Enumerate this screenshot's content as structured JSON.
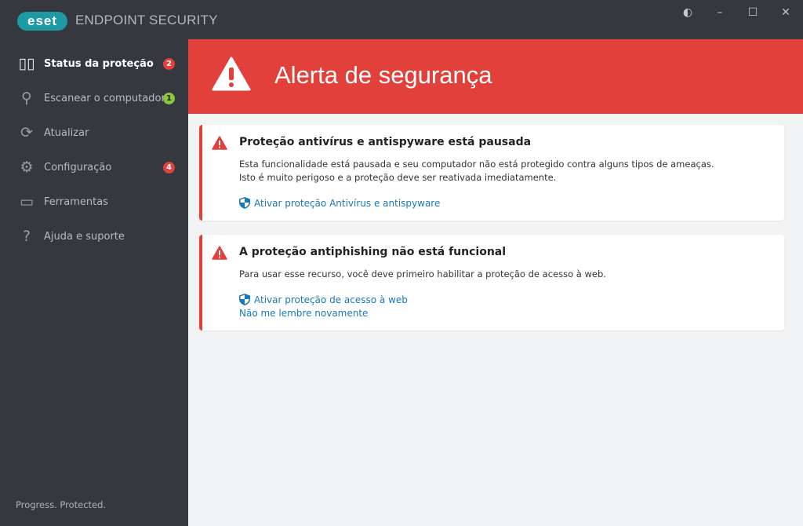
{
  "app": {
    "logo": "eset",
    "product": "ENDPOINT SECURITY"
  },
  "window": {
    "theme_icon": "contrast-icon",
    "minimize": "–",
    "maximize": "☐",
    "close": "✕"
  },
  "sidebar": {
    "items": [
      {
        "label": "Status da proteção",
        "badge": "2",
        "badge_color": "#e2403a",
        "icon": "dashboard-icon"
      },
      {
        "label": "Escanear o computador",
        "badge": "1",
        "badge_color": "#8cc63f",
        "icon": "search-icon"
      },
      {
        "label": "Atualizar",
        "icon": "refresh-icon"
      },
      {
        "label": "Configuração",
        "badge": "4",
        "badge_color": "#e2403a",
        "icon": "gear-icon"
      },
      {
        "label": "Ferramentas",
        "icon": "briefcase-icon"
      },
      {
        "label": "Ajuda e suporte",
        "icon": "help-icon"
      }
    ],
    "footer": "Progress. Protected."
  },
  "main": {
    "title": "Alerta de segurança",
    "alerts": [
      {
        "title": "Proteção antivírus e antispyware está pausada",
        "lines": [
          "Esta funcionalidade está pausada e seu computador não está protegido contra alguns tipos de ameaças.",
          "Isto é muito perigoso e a proteção deve ser reativada imediatamente."
        ],
        "action": "Ativar proteção Antivírus e antispyware"
      },
      {
        "title": "A proteção antiphishing não está funcional",
        "lines": [
          "Para usar esse recurso, você deve primeiro habilitar a proteção de acesso à web."
        ],
        "action": "Ativar proteção de acesso à web",
        "secondary": "Não me lembre novamente"
      }
    ]
  },
  "colors": {
    "accent": "#e2403a",
    "link": "#1a79b8",
    "sidebar": "#35383f"
  }
}
